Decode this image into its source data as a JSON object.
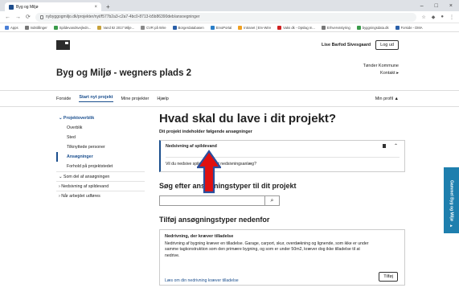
{
  "browser": {
    "tab_title": "Byg og Miljø",
    "tab_close": "×",
    "new_tab": "+",
    "url": "nybyggogmiljo.dk/projekter/nyt/f577b2a3-c2a7-4bc0-8713-b5b86390deb/ansoegninger",
    "bookmarks": [
      "Apps",
      "Indstillinger",
      "Spildevandsvejledn...",
      "Vand 8z 2017 Milje...",
      "CVR på Wire",
      "Borgerdatabasen",
      "ErvoPortal",
      "Intranet | Erv-Wire",
      "Vaks dk - Opslag m...",
      "Erhvervsstyring",
      "byggningsdata.dk",
      "Forside - DMA"
    ],
    "nav_glyphs": [
      "←",
      "→",
      "⟳"
    ],
    "window_controls": [
      "–",
      "□",
      "×"
    ]
  },
  "site": {
    "user_name": "Lise Barfod Sivesgaard",
    "logout_label": "Log ud",
    "title": "Byg og Miljø - wegners plads 2",
    "municipality": "Tønder Kommune",
    "contact_label": "Kontakt ▸",
    "nav": [
      "Forside",
      "Start nyt projekt",
      "Mine projekter",
      "Hjælp"
    ],
    "profile_label": "Min profil ▲"
  },
  "sidebar": {
    "heading": "Projektoverblik",
    "items": [
      "Overblik",
      "Sted",
      "Tilknyttede personer",
      "Ansøgninger",
      "Forhold på projektstedet"
    ],
    "sections": [
      "Som del af ansøgningen",
      "Nedsivning af spildevand",
      "Når arbejdet udføres"
    ]
  },
  "main": {
    "heading": "Hvad skal du lave i dit projekt?",
    "subheading": "Dit projekt indeholder følgende ansøgninger",
    "application_title": "Nedsivning af spildevand",
    "application_question": "Vil du nedsive spildevand i et nedsivningsanlæg?",
    "search_heading": "Søg efter ansøgningstyper til dit projekt",
    "search_placeholder": "",
    "add_heading": "Tilføj ansøgningstyper nedenfor",
    "card_title": "Nedrivning, der kræver tilladelse",
    "card_text": "Nedrivning af bygning kræver en tilladelse. Garage, carport, skur, overdækning og lignende, som ikke er under samme tagkonstruktion som den primære bygning, og som er under 50m2, kræver dog ikke tilladelse til at nedrive.",
    "card_link": "Læs om din nedrivning kræver tilladelse",
    "add_button": "Tilføj"
  },
  "feedback_tab": "Gammel Byg og Miljø",
  "colors": {
    "accent": "#1b4f8e",
    "feedback": "#1e7fae",
    "arrow_fill": "#e01010",
    "arrow_stroke": "#2a4f9e"
  }
}
